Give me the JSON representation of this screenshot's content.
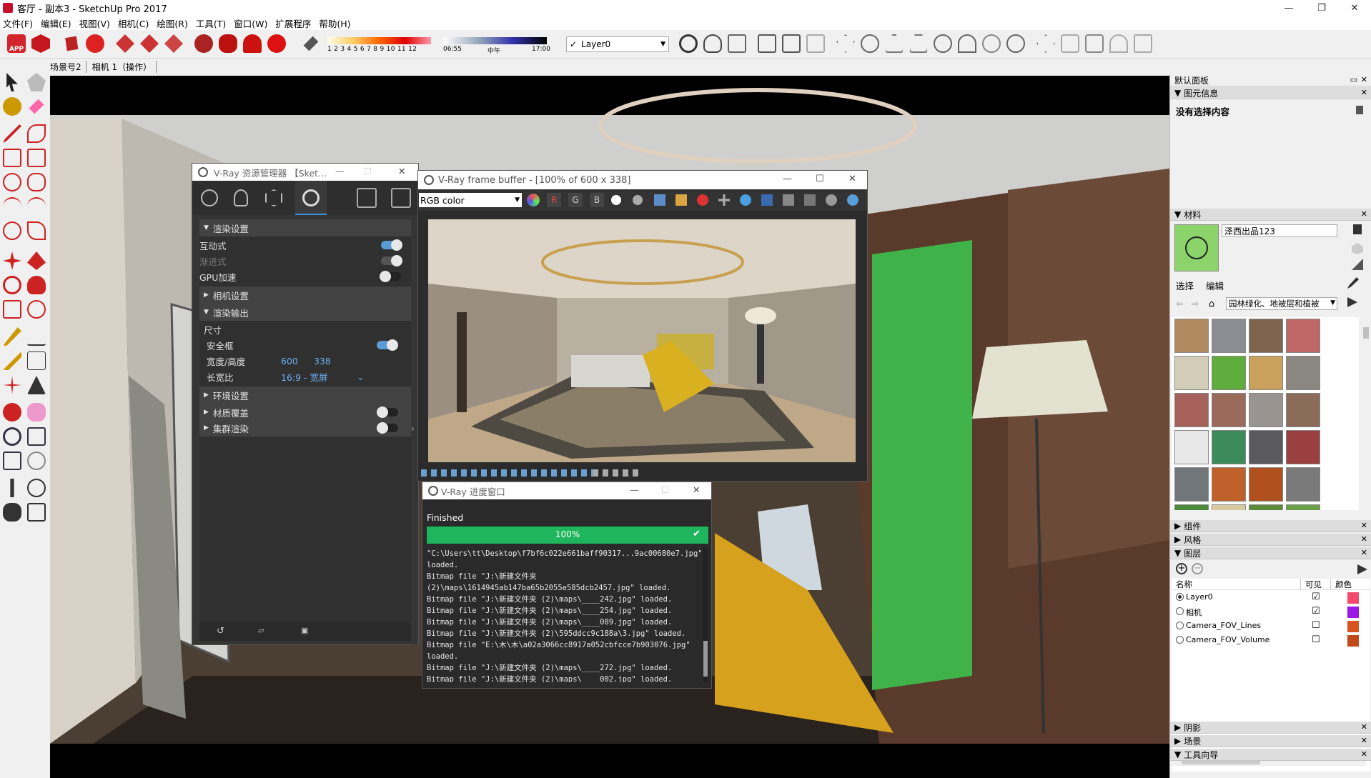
{
  "window": {
    "title": "客厅 - 副本3 - SketchUp Pro 2017"
  },
  "menu": [
    "文件(F)",
    "编辑(E)",
    "视图(V)",
    "相机(C)",
    "绘图(R)",
    "工具(T)",
    "窗口(W)",
    "扩展程序",
    "帮助(H)"
  ],
  "toolbar": {
    "shadow_months": "1 2 3 4 5 6 7 8 9 10 11 12",
    "time_start": "06:55",
    "time_mid": "中午",
    "time_end": "17:00",
    "layer": "Layer0",
    "brand_icon": "APP"
  },
  "scenes": [
    "场景号2",
    "相机 1（操作）"
  ],
  "vray_asset_editor": {
    "title": "V-Ray 资源管理器 【Sket...",
    "render_settings": "渲染设置",
    "interactive": "互动式",
    "progressive": "渐进式",
    "gpu": "GPU加速",
    "camera": "相机设置",
    "render_output": "渲染输出",
    "size": "尺寸",
    "safe_frame": "安全框",
    "width_height": "宽度/高度",
    "width": "600",
    "height": "338",
    "aspect_label": "长宽比",
    "aspect_value": "16:9 - 宽屏",
    "environment": "环境设置",
    "material_override": "材质覆盖",
    "swarm": "集群渲染"
  },
  "vfb": {
    "title": "V-Ray frame buffer - [100% of 600 x 338]",
    "channel": "RGB color",
    "r": "R",
    "g": "G",
    "b": "B"
  },
  "progress": {
    "title": "V-Ray 进度窗口",
    "status": "Finished",
    "percent": "100%",
    "log": [
      "\"C:\\Users\\tt\\Desktop\\f7bf6c022e661baff90317...9ac00680e7.jpg\"",
      "loaded.",
      "Bitmap file \"J:\\新建文件夹",
      "(2)\\maps\\1614945ab147ba65b2055e585dcb2457.jpg\" loaded.",
      "Bitmap file \"J:\\新建文件夹 (2)\\maps\\____242.jpg\" loaded.",
      "Bitmap file \"J:\\新建文件夹 (2)\\maps\\____254.jpg\" loaded.",
      "Bitmap file \"J:\\新建文件夹 (2)\\maps\\____089.jpg\" loaded.",
      "Bitmap file \"J:\\新建文件夹 (2)\\595ddcc9c188a\\3.jpg\" loaded.",
      "Bitmap file \"E:\\木\\木\\a02a3066cc8917a052cbfcce7b903076.jpg\"",
      "loaded.",
      "Bitmap file \"J:\\新建文件夹 (2)\\maps\\____272.jpg\" loaded.",
      "Bitmap file \"J:\\新建文件夹 (2)\\maps\\____002.jpg\" loaded."
    ]
  },
  "right_panel": {
    "tray": "默认面板",
    "entity_info": "图元信息",
    "no_selection": "没有选择内容",
    "materials": "材料",
    "material_name": "泽西出品123",
    "tab_select": "选择",
    "tab_edit": "编辑",
    "library": "园林绿化、地被层和植被",
    "components": "组件",
    "styles": "风格",
    "layers": "图层",
    "col_name": "名称",
    "col_visible": "可见",
    "col_color": "颜色",
    "layer_rows": [
      {
        "name": "Layer0",
        "visible": "☑",
        "color": "#f24a6b"
      },
      {
        "name": "相机",
        "visible": "☑",
        "color": "#9b18e6"
      },
      {
        "name": "Camera_FOV_Lines",
        "visible": "☐",
        "color": "#d9531e"
      },
      {
        "name": "Camera_FOV_Volume",
        "visible": "☐",
        "color": "#c2491a"
      }
    ],
    "shadows": "阴影",
    "scenes_panel": "场景",
    "instructor": "工具向导"
  }
}
